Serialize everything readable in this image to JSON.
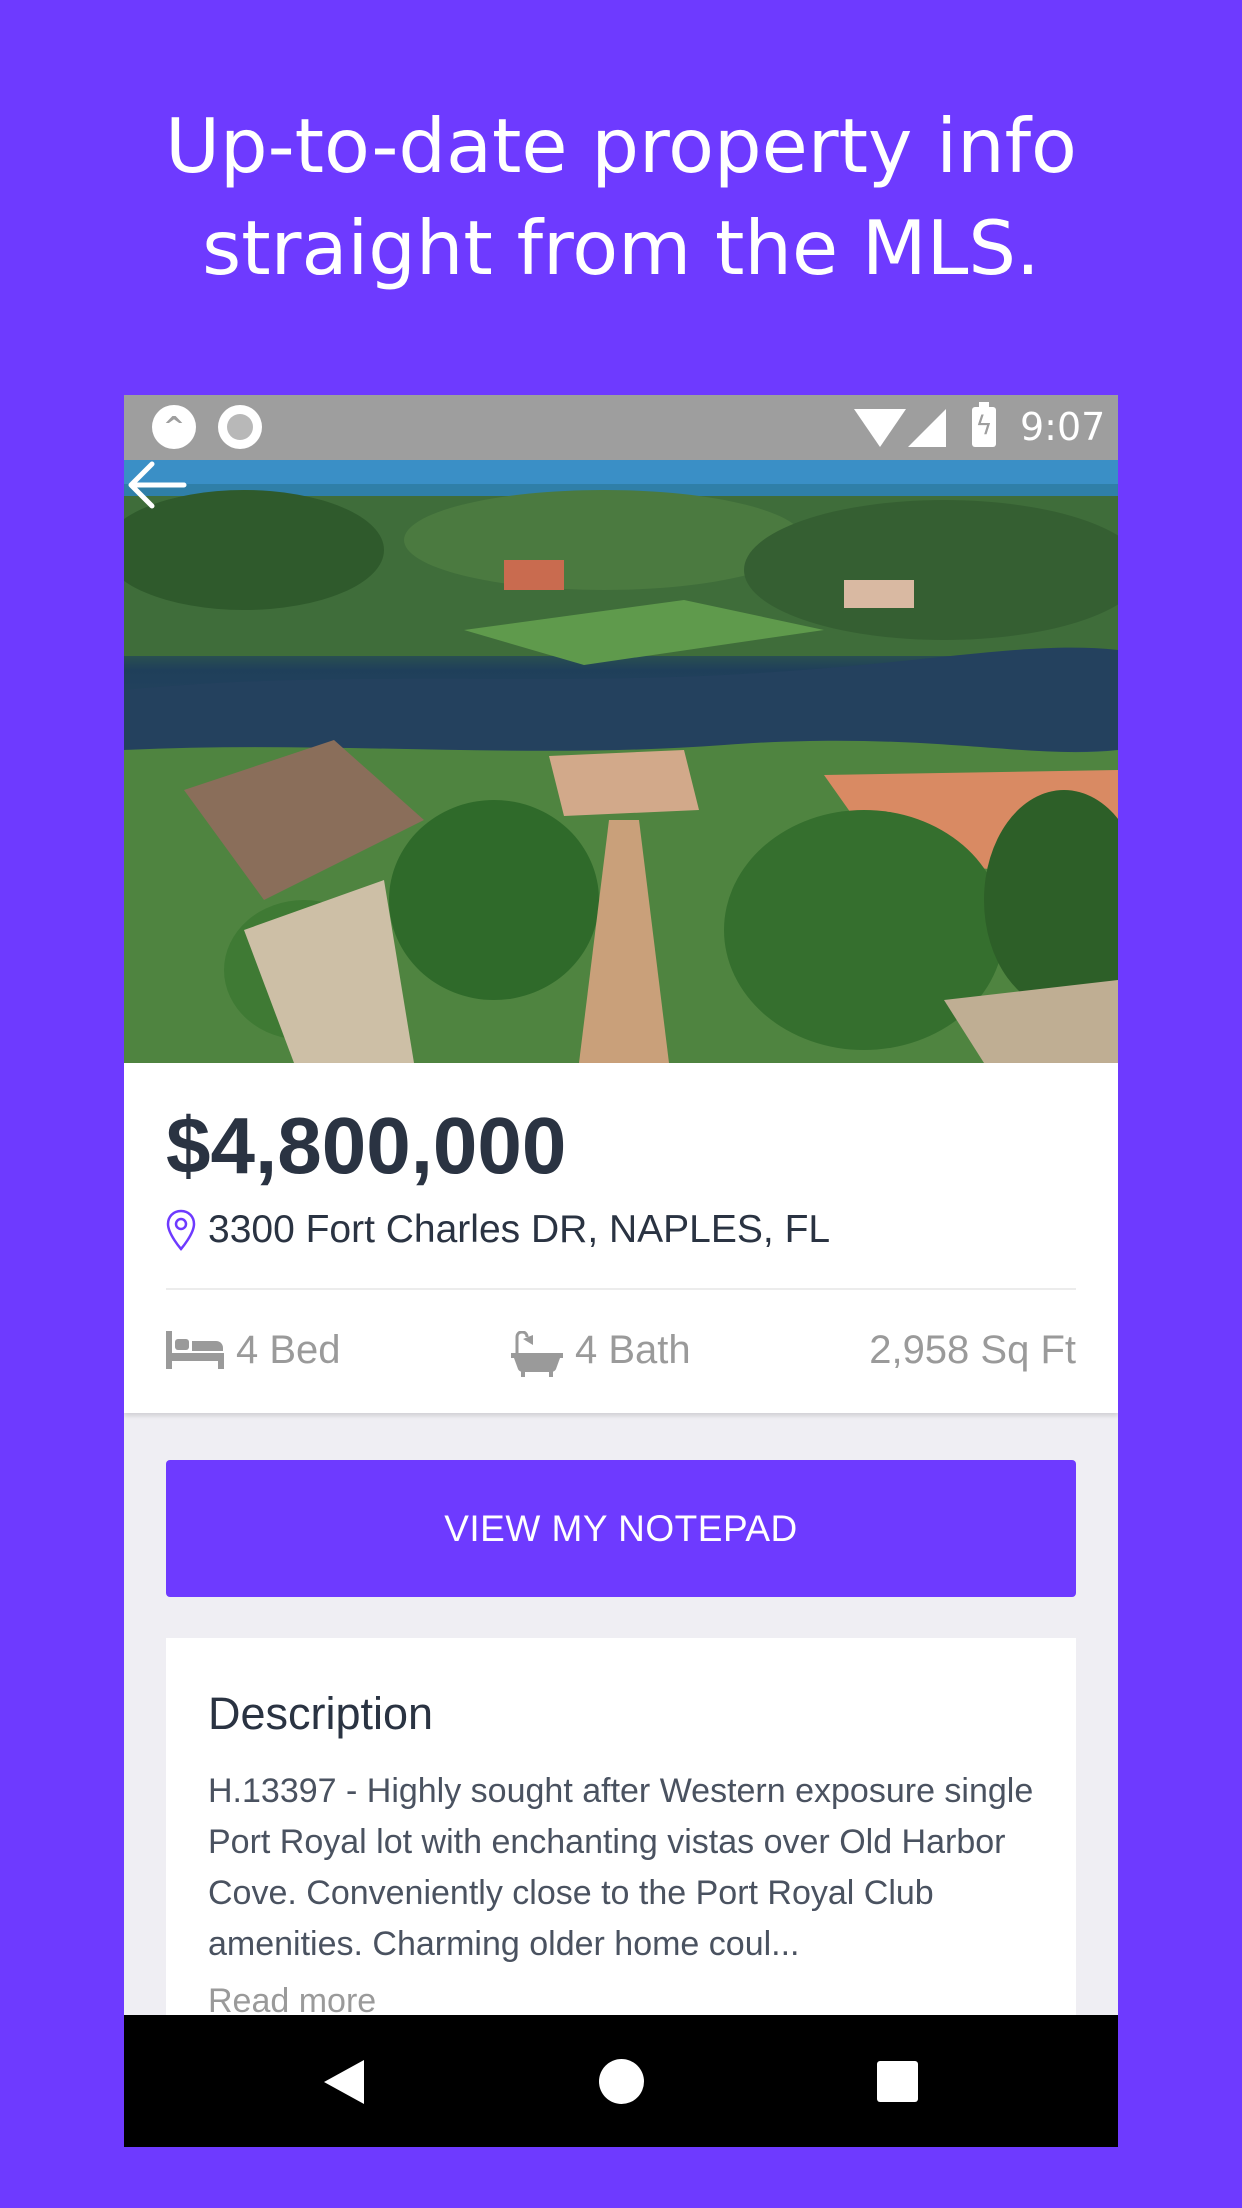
{
  "promo": {
    "headline_line1": "Up-to-date property info",
    "headline_line2": "straight from the MLS.",
    "background_color": "#6e3aff"
  },
  "status_bar": {
    "time": "9:07",
    "icons": [
      "app-icon",
      "record-icon",
      "wifi-icon",
      "cell-signal-icon",
      "battery-charging-icon"
    ]
  },
  "listing": {
    "hero_image": "aerial view of waterfront homes",
    "price": "$4,800,000",
    "address": "3300 Fort Charles DR, NAPLES, FL",
    "beds": "4 Bed",
    "baths": "4 Bath",
    "area": "2,958 Sq Ft"
  },
  "actions": {
    "notepad_label": "VIEW MY NOTEPAD"
  },
  "description": {
    "title": "Description",
    "text": "H.13397 - Highly sought after Western exposure single Port Royal lot with enchanting vistas over Old Harbor Cove. Conveniently close to the Port Royal Club amenities. Charming older home coul...",
    "read_more": "Read more"
  },
  "nav_bar": {
    "icons": [
      "nav-back-icon",
      "nav-home-icon",
      "nav-recents-icon"
    ]
  },
  "colors": {
    "accent": "#6e3aff",
    "text_dark": "#2a3342",
    "text_muted": "#9a9a9a"
  }
}
